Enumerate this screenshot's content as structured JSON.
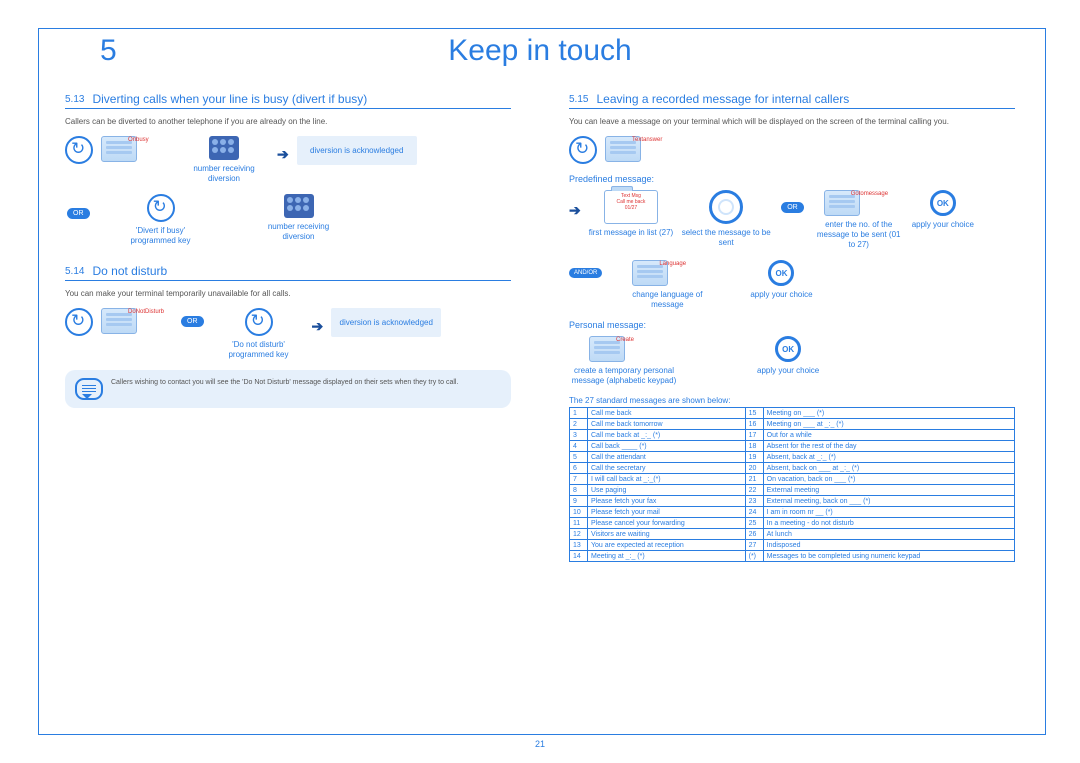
{
  "chapter": "5",
  "title": "Keep in touch",
  "page_number": "21",
  "s513": {
    "num": "5.13",
    "title": "Diverting calls when your line is busy (divert if busy)",
    "intro": "Callers can be diverted to another telephone if you are already on the line.",
    "soft_label": "Onbusy",
    "cap_num1": "number receiving diversion",
    "ack": "diversion is acknowledged",
    "or": "OR",
    "cap_divertkey": "'Divert if busy' programmed key",
    "cap_num2": "number receiving diversion"
  },
  "s514": {
    "num": "5.14",
    "title": "Do not disturb",
    "intro": "You can make your terminal temporarily unavailable for all calls.",
    "soft_label": "DoNotDisturb",
    "or": "OR",
    "cap_dnd": "'Do not disturb' programmed key",
    "ack": "diversion is acknowledged",
    "note": "Callers wishing to contact you will see the 'Do Not Disturb' message displayed on their sets when they try to call."
  },
  "s515": {
    "num": "5.15",
    "title": "Leaving a recorded message for internal callers",
    "intro": "You can leave a message on your terminal which will be displayed on the screen of the terminal calling you.",
    "soft_textanswer": "Textanswer",
    "predef": "Predefined message:",
    "screen_lines": [
      "Text Msg",
      "Call me back",
      "01/27"
    ],
    "cap_first": "first message in list (27)",
    "cap_select": "select the message to be sent",
    "soft_goto": "Gotomessage",
    "cap_enter": "enter the no. of the message to be sent (01 to 27)",
    "cap_apply": "apply your choice",
    "or": "OR",
    "andor": "AND/OR",
    "soft_lang": "Language",
    "cap_lang": "change language of message",
    "cap_apply2": "apply your choice",
    "personal": "Personal message:",
    "soft_create": "Create",
    "cap_create": "create a temporary personal message (alphabetic keypad)",
    "cap_apply3": "apply your choice",
    "table_intro": "The 27 standard messages are shown below:",
    "messages": [
      [
        "1",
        "Call me back",
        "15",
        "Meeting on ___ (*)"
      ],
      [
        "2",
        "Call me back tomorrow",
        "16",
        "Meeting on ___ at _:_ (*)"
      ],
      [
        "3",
        "Call me back at _:_ (*)",
        "17",
        "Out for a while"
      ],
      [
        "4",
        "Call back ____ (*)",
        "18",
        "Absent for the rest of the day"
      ],
      [
        "5",
        "Call the attendant",
        "19",
        "Absent, back at _:_ (*)"
      ],
      [
        "6",
        "Call the secretary",
        "20",
        "Absent, back on ___ at _:_ (*)"
      ],
      [
        "7",
        "I will call back at _:_(*)",
        "21",
        "On vacation, back on ___ (*)"
      ],
      [
        "8",
        "Use paging",
        "22",
        "External meeting"
      ],
      [
        "9",
        "Please fetch your fax",
        "23",
        "External meeting, back on ___ (*)"
      ],
      [
        "10",
        "Please fetch your mail",
        "24",
        "I am in room nr __ (*)"
      ],
      [
        "11",
        "Please cancel your forwarding",
        "25",
        "In a meeting - do not disturb"
      ],
      [
        "12",
        "Visitors are waiting",
        "26",
        "At lunch"
      ],
      [
        "13",
        "You are expected at reception",
        "27",
        "Indisposed"
      ],
      [
        "14",
        "Meeting at _:_ (*)",
        "(*)",
        "Messages to be completed using numeric keypad"
      ]
    ]
  }
}
